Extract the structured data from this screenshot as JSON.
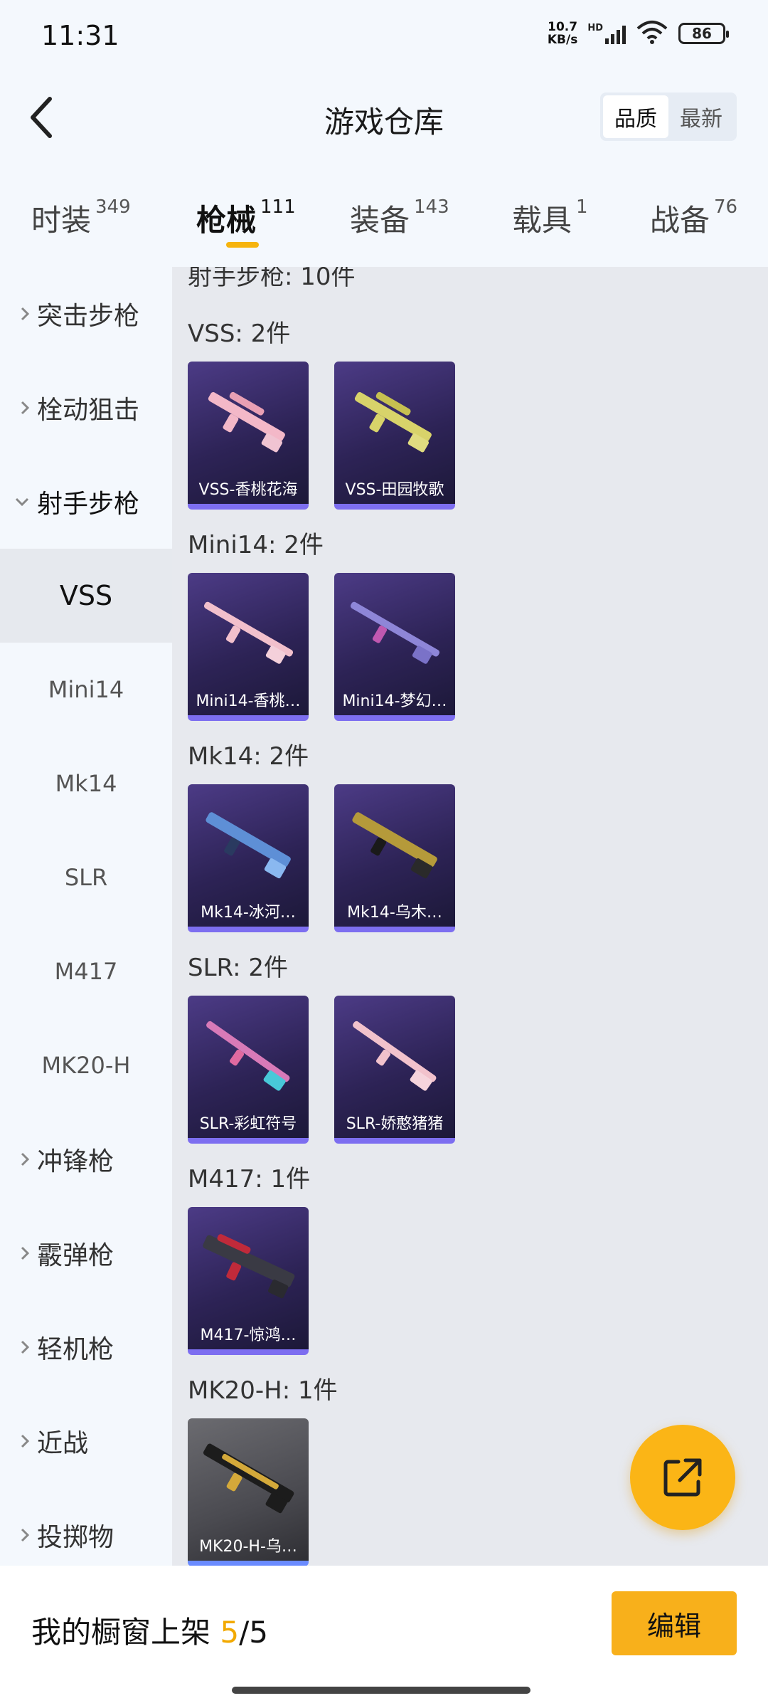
{
  "status": {
    "time": "11:31",
    "netspeed_value": "10.7",
    "netspeed_unit": "KB/s",
    "hd": "HD",
    "battery": "86"
  },
  "header": {
    "title": "游戏仓库",
    "sort_options": [
      "品质",
      "最新"
    ]
  },
  "tabs": [
    {
      "label": "时装",
      "count": "349"
    },
    {
      "label": "枪械",
      "count": "111"
    },
    {
      "label": "装备",
      "count": "143"
    },
    {
      "label": "载具",
      "count": "1"
    },
    {
      "label": "战备",
      "count": "76"
    }
  ],
  "sidebar": {
    "items": [
      "突击步枪",
      "栓动狙击",
      "射手步枪",
      "冲锋枪",
      "霰弹枪",
      "轻机枪",
      "近战",
      "投掷物"
    ],
    "sub_items": [
      "VSS",
      "Mini14",
      "Mk14",
      "SLR",
      "M417",
      "MK20-H"
    ]
  },
  "content": {
    "clipped_heading": "射手步枪: 10件",
    "sections": [
      {
        "heading": "VSS: 2件",
        "items": [
          "VSS-香桃花海",
          "VSS-田园牧歌"
        ]
      },
      {
        "heading": "Mini14: 2件",
        "items": [
          "Mini14-香桃…",
          "Mini14-梦幻…"
        ]
      },
      {
        "heading": "Mk14: 2件",
        "items": [
          "Mk14-冰河…",
          "Mk14-乌木…"
        ]
      },
      {
        "heading": "SLR: 2件",
        "items": [
          "SLR-彩虹符号",
          "SLR-娇憨猪猪"
        ]
      },
      {
        "heading": "M417: 1件",
        "items": [
          "M417-惊鸿…"
        ]
      },
      {
        "heading": "MK20-H: 1件",
        "items": [
          "MK20-H-乌…"
        ]
      }
    ]
  },
  "bottom": {
    "label": "我的橱窗上架",
    "current": "5",
    "sep_total": "/5",
    "edit": "编辑"
  },
  "colors": {
    "accent": "#f8b01b",
    "card_bg": "#2d2356",
    "card_border": "#7d6ef0"
  }
}
